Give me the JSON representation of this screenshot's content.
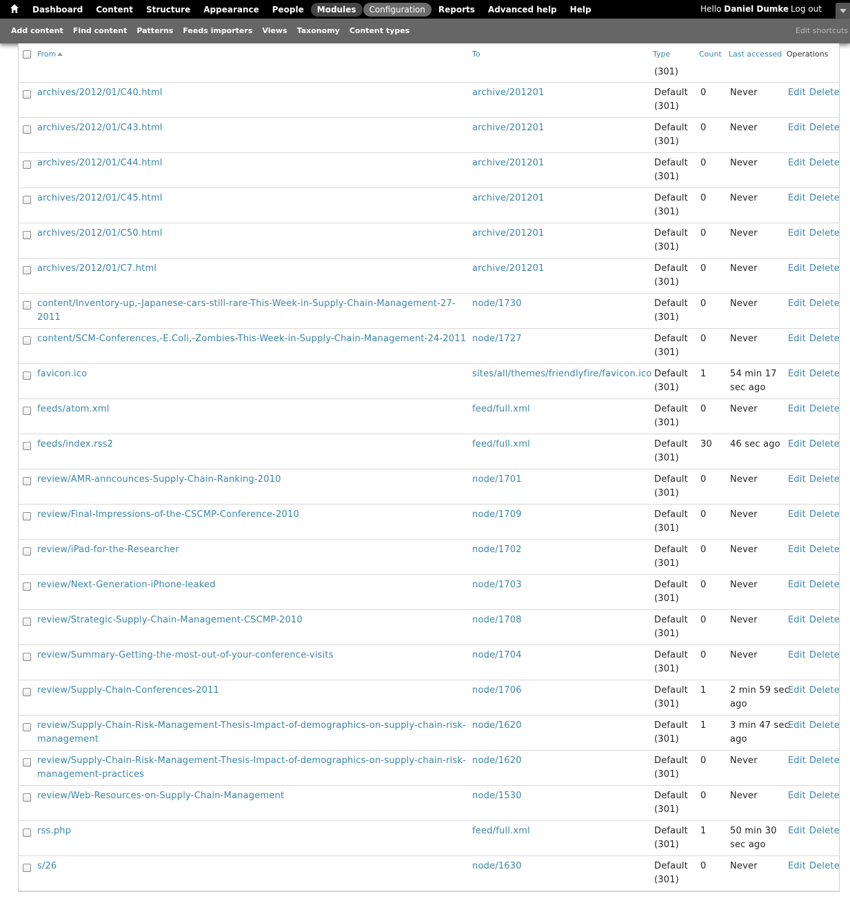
{
  "toolbar": {
    "home_icon": "home-icon",
    "menu": [
      "Dashboard",
      "Content",
      "Structure",
      "Appearance",
      "People",
      "Modules",
      "Configuration",
      "Reports",
      "Advanced help",
      "Help"
    ],
    "active_item": "Modules",
    "selected_item": "Configuration",
    "user_greeting": "Hello",
    "user_name": "Daniel Dumke",
    "logout": "Log out"
  },
  "shortcuts": {
    "links": [
      "Add content",
      "Find content",
      "Patterns",
      "Feeds importers",
      "Views",
      "Taxonomy",
      "Content types"
    ],
    "edit_label": "Edit shortcuts"
  },
  "table": {
    "headers": {
      "from": "From",
      "to": "To",
      "type": "Type",
      "count": "Count",
      "last_accessed": "Last accessed",
      "operations": "Operations"
    },
    "partial_row_text": "(301)",
    "edit_label": "Edit",
    "delete_label": "Delete",
    "rows": [
      {
        "from": "archives/2012/01/C40.html",
        "to": "archive/201201",
        "type": "Default (301)",
        "count": "0",
        "last": "Never"
      },
      {
        "from": "archives/2012/01/C43.html",
        "to": "archive/201201",
        "type": "Default (301)",
        "count": "0",
        "last": "Never"
      },
      {
        "from": "archives/2012/01/C44.html",
        "to": "archive/201201",
        "type": "Default (301)",
        "count": "0",
        "last": "Never"
      },
      {
        "from": "archives/2012/01/C45.html",
        "to": "archive/201201",
        "type": "Default (301)",
        "count": "0",
        "last": "Never"
      },
      {
        "from": "archives/2012/01/C50.html",
        "to": "archive/201201",
        "type": "Default (301)",
        "count": "0",
        "last": "Never"
      },
      {
        "from": "archives/2012/01/C7.html",
        "to": "archive/201201",
        "type": "Default (301)",
        "count": "0",
        "last": "Never"
      },
      {
        "from": "content/Inventory-up,-Japanese-cars-still-rare-This-Week-in-Supply-Chain-Management-27-2011",
        "to": "node/1730",
        "type": "Default (301)",
        "count": "0",
        "last": "Never"
      },
      {
        "from": "content/SCM-Conferences,-E.Coli,-Zombies-This-Week-in-Supply-Chain-Management-24-2011",
        "to": "node/1727",
        "type": "Default (301)",
        "count": "0",
        "last": "Never"
      },
      {
        "from": "favicon.ico",
        "to": "sites/all/themes/friendlyfire/favicon.ico",
        "type": "Default (301)",
        "count": "1",
        "last": "54 min 17 sec ago"
      },
      {
        "from": "feeds/atom.xml",
        "to": "feed/full.xml",
        "type": "Default (301)",
        "count": "0",
        "last": "Never"
      },
      {
        "from": "feeds/index.rss2",
        "to": "feed/full.xml",
        "type": "Default (301)",
        "count": "30",
        "last": "46 sec ago"
      },
      {
        "from": "review/AMR-anncounces-Supply-Chain-Ranking-2010",
        "to": "node/1701",
        "type": "Default (301)",
        "count": "0",
        "last": "Never"
      },
      {
        "from": "review/Final-Impressions-of-the-CSCMP-Conference-2010",
        "to": "node/1709",
        "type": "Default (301)",
        "count": "0",
        "last": "Never"
      },
      {
        "from": "review/iPad-for-the-Researcher",
        "to": "node/1702",
        "type": "Default (301)",
        "count": "0",
        "last": "Never"
      },
      {
        "from": "review/Next-Generation-iPhone-leaked",
        "to": "node/1703",
        "type": "Default (301)",
        "count": "0",
        "last": "Never"
      },
      {
        "from": "review/Strategic-Supply-Chain-Management-CSCMP-2010",
        "to": "node/1708",
        "type": "Default (301)",
        "count": "0",
        "last": "Never"
      },
      {
        "from": "review/Summary-Getting-the-most-out-of-your-conference-visits",
        "to": "node/1704",
        "type": "Default (301)",
        "count": "0",
        "last": "Never"
      },
      {
        "from": "review/Supply-Chain-Conferences-2011",
        "to": "node/1706",
        "type": "Default (301)",
        "count": "1",
        "last": "2 min 59 sec ago"
      },
      {
        "from": "review/Supply-Chain-Risk-Management-Thesis-Impact-of-demographics-on-supply-chain-risk-management",
        "to": "node/1620",
        "type": "Default (301)",
        "count": "1",
        "last": "3 min 47 sec ago"
      },
      {
        "from": "review/Supply-Chain-Risk-Management-Thesis-Impact-of-demographics-on-supply-chain-risk-management-practices",
        "to": "node/1620",
        "type": "Default (301)",
        "count": "0",
        "last": "Never"
      },
      {
        "from": "review/Web-Resources-on-Supply-Chain-Management",
        "to": "node/1530",
        "type": "Default (301)",
        "count": "0",
        "last": "Never"
      },
      {
        "from": "rss.php",
        "to": "feed/full.xml",
        "type": "Default (301)",
        "count": "1",
        "last": "50 min 30 sec ago"
      },
      {
        "from": "s/26",
        "to": "node/1630",
        "type": "Default (301)",
        "count": "0",
        "last": "Never"
      }
    ]
  },
  "colors": {
    "link": "#3b86a6",
    "toolbar_bg": "#000000",
    "shortcuts_bg": "#666666",
    "row_border": "#d9d9d9"
  }
}
